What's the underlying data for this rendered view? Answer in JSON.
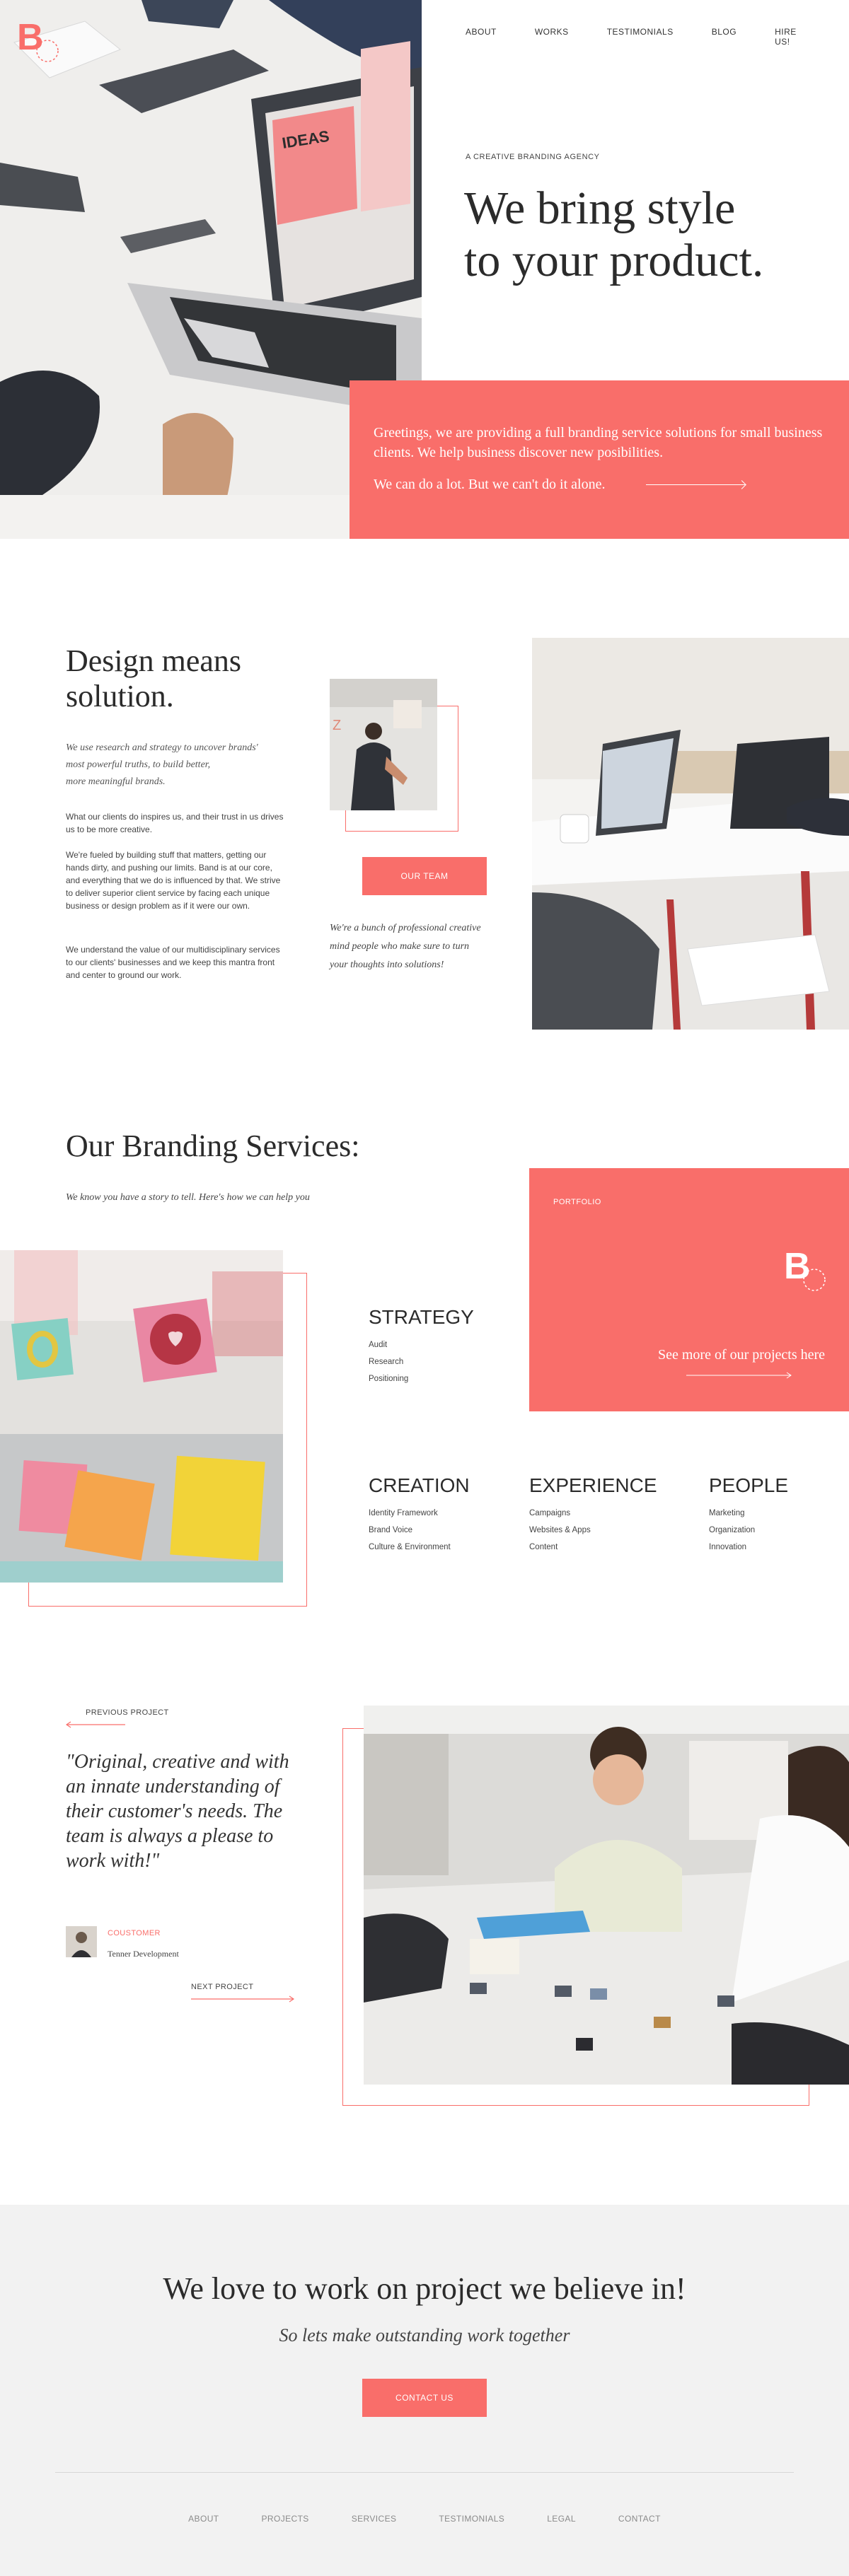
{
  "brand": {
    "logo_letter": "B",
    "accent": "#f96e6a"
  },
  "nav": {
    "items": [
      "ABOUT",
      "WORKS",
      "TESTIMONIALS",
      "BLOG",
      "HIRE US!"
    ]
  },
  "hero": {
    "eyebrow": "A CREATIVE BRANDING AGENCY",
    "title_line1": "We bring style",
    "title_line2": "to your product.",
    "box_text": "Greetings, we are providing a full branding service solutions for small business clients. We help business discover new posibilities.",
    "box_cta": "We can do a lot. But we can't do it alone.",
    "laptop_screen_word": "IDEAS"
  },
  "design": {
    "title_line1": "Design means",
    "title_line2": "solution.",
    "lead_line1": "We use research and strategy to uncover brands'",
    "lead_line2": "most powerful truths, to build better,",
    "lead_line3": "more meaningful brands.",
    "p1": "What our clients do inspires us, and their trust in us drives us to be more creative.",
    "p2": "We're fueled by building stuff that matters, getting our hands dirty, and pushing our limits. Band is at our core, and everything that we do is influenced by that. We strive to deliver superior client service by facing each unique business or design problem as if it were our own.",
    "p3": "We understand the value of our multidisciplinary services to our clients' businesses and we keep this mantra front and center to ground our work.",
    "team_button": "OUR TEAM",
    "team_text": "We're a bunch of professional creative mind people who make sure to turn your thoughts into solutions!"
  },
  "services": {
    "title": "Our Branding Services:",
    "subtitle": "We know you have a story to tell. Here's how we can help you",
    "portfolio_label": "PORTFOLIO",
    "portfolio_link": "See more of our projects here",
    "groups": [
      {
        "title": "STRATEGY",
        "items": [
          "Audit",
          "Research",
          "Positioning"
        ]
      },
      {
        "title": "CREATION",
        "items": [
          "Identity Framework",
          "Brand Voice",
          "Culture & Environment"
        ]
      },
      {
        "title": "EXPERIENCE",
        "items": [
          "Campaigns",
          "Websites & Apps",
          "Content"
        ]
      },
      {
        "title": "PEOPLE",
        "items": [
          "Marketing",
          "Organization",
          "Innovation"
        ]
      }
    ]
  },
  "testimonial": {
    "prev": "PREVIOUS PROJECT",
    "next": "NEXT PROJECT",
    "quote": "\"Original, creative and with an innate understanding of their customer's needs. The team is always a please to work with!\"",
    "role": "COUSTOMER",
    "name": "Tenner Development"
  },
  "bottom": {
    "title": "We love to work on project we believe in!",
    "subtitle": "So lets make outstanding work together",
    "button": "CONTACT US"
  },
  "footer": {
    "items": [
      "ABOUT",
      "PROJECTS",
      "SERVICES",
      "TESTIMONIALS",
      "LEGAL",
      "CONTACT"
    ]
  }
}
